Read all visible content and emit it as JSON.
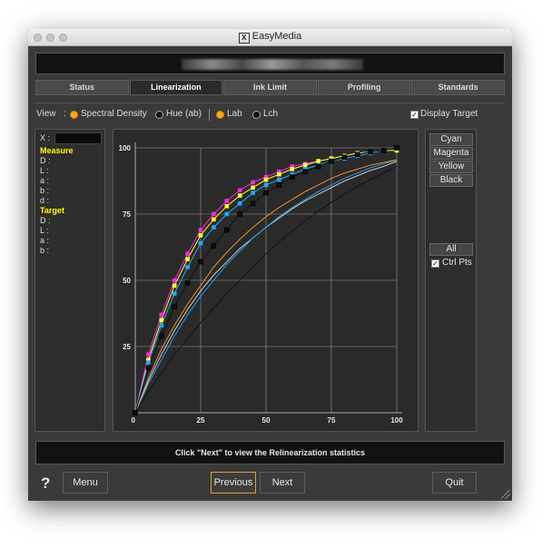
{
  "window": {
    "title": "EasyMedia"
  },
  "tabs": [
    {
      "label": "Status",
      "active": false
    },
    {
      "label": "Linearization",
      "active": true
    },
    {
      "label": "Ink Limit",
      "active": false
    },
    {
      "label": "Profiling",
      "active": false
    },
    {
      "label": "Standards",
      "active": false
    }
  ],
  "view": {
    "label": "View",
    "colon": ":",
    "options": [
      {
        "label": "Spectral Density",
        "selected": true
      },
      {
        "label": "Hue (ab)",
        "selected": false
      }
    ],
    "space_options": [
      {
        "label": "Lab",
        "selected": true
      },
      {
        "label": "Lch",
        "selected": false
      }
    ],
    "display_target_label": "Display Target",
    "display_target_checked": true
  },
  "left_panel": {
    "x_label": "X :",
    "measure_heading": "Measure",
    "measure_fields": [
      "D :",
      "L :",
      "a :",
      "b :",
      "d :"
    ],
    "target_heading": "Target",
    "target_fields": [
      "D :",
      "L :",
      "a :",
      "b :"
    ]
  },
  "right_panel": {
    "channel_buttons": [
      "Cyan",
      "Magenta",
      "Yellow",
      "Black"
    ],
    "all_button": "All",
    "ctrl_pts_label": "Ctrl Pts",
    "ctrl_pts_checked": true
  },
  "status_message": "Click \"Next\" to view the Relinearization statistics",
  "footer": {
    "help_label": "?",
    "menu_label": "Menu",
    "previous_label": "Previous",
    "next_label": "Next",
    "quit_label": "Quit"
  },
  "chart_data": {
    "type": "line",
    "xlim": [
      0,
      100
    ],
    "ylim": [
      0,
      100
    ],
    "x_ticks": [
      0,
      25,
      50,
      75,
      100
    ],
    "y_ticks": [
      25,
      50,
      75,
      100
    ],
    "grid": true,
    "colors": {
      "cyan": "#21a8ff",
      "magenta": "#ff2bd2",
      "yellow": "#ffff33",
      "black": "#111111",
      "target": "#dadada",
      "orange": "#ff9a2a"
    },
    "x_points": [
      0,
      5,
      10,
      15,
      20,
      25,
      30,
      35,
      40,
      45,
      50,
      55,
      60,
      65,
      70,
      75,
      80,
      85,
      90,
      95,
      100
    ],
    "series": [
      {
        "color": "magenta",
        "values": [
          0,
          22,
          37,
          50,
          60,
          69,
          75,
          80,
          84,
          87,
          89,
          91,
          93,
          94,
          95,
          96,
          97,
          98,
          98.5,
          99,
          100
        ]
      },
      {
        "color": "yellow",
        "values": [
          0,
          20,
          35,
          48,
          58,
          67,
          73,
          78,
          82,
          85,
          88,
          90,
          92,
          93.5,
          95,
          96,
          97,
          98,
          98.5,
          99,
          99
        ]
      },
      {
        "color": "cyan",
        "values": [
          0,
          19,
          33,
          45,
          55,
          64,
          70,
          75,
          79,
          83,
          86,
          88,
          90,
          92,
          93.5,
          95,
          96,
          97,
          98,
          99,
          100
        ]
      },
      {
        "color": "black",
        "values": [
          0,
          17,
          29,
          40,
          49,
          57,
          63,
          69,
          75,
          79,
          83,
          86,
          89,
          91,
          93,
          95,
          96.5,
          97.5,
          98.5,
          99,
          100
        ]
      }
    ],
    "reference_curves": [
      {
        "color": "target",
        "values": [
          0,
          12,
          22,
          31,
          39,
          46,
          52,
          57,
          62,
          66,
          70,
          73.5,
          77,
          80,
          82.5,
          85,
          87.5,
          89.5,
          91.5,
          93,
          95
        ]
      },
      {
        "color": "cyan",
        "values": [
          0,
          11,
          20,
          29,
          37,
          44,
          50,
          56,
          61,
          66,
          70,
          74,
          77.5,
          80.5,
          83.5,
          86,
          88.5,
          90.5,
          92.5,
          94,
          95.5
        ]
      },
      {
        "color": "orange",
        "values": [
          0,
          13,
          24,
          33,
          41,
          48,
          55,
          60.5,
          65.5,
          70,
          74,
          77.5,
          80.5,
          83.5,
          86,
          88.5,
          90.5,
          92,
          93.5,
          94.5,
          95.5
        ]
      },
      {
        "color": "black",
        "values": [
          0,
          8,
          15,
          22,
          28,
          34,
          39.5,
          45,
          50,
          55,
          60,
          64.5,
          68.5,
          72.5,
          76,
          79.5,
          82.5,
          85.5,
          88,
          90.5,
          93
        ]
      }
    ]
  }
}
